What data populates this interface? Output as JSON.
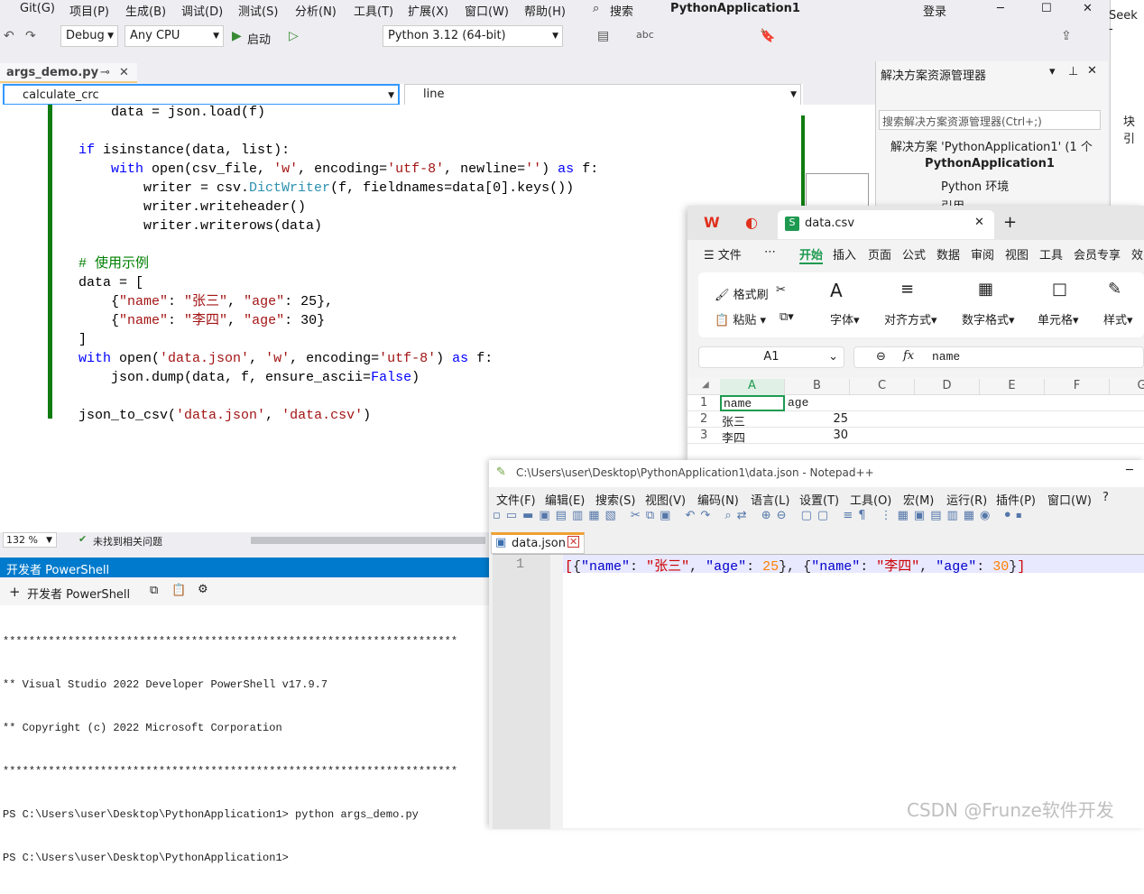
{
  "vs": {
    "menu": [
      "Git(G)",
      "项目(P)",
      "生成(B)",
      "调试(D)",
      "测试(S)",
      "分析(N)",
      "工具(T)",
      "扩展(X)",
      "窗口(W)",
      "帮助(H)"
    ],
    "search_label": "搜索",
    "app_title": "PythonApplication1",
    "login": "登录",
    "config": "Debug",
    "platform": "Any CPU",
    "start": "启动",
    "interpreter": "Python 3.12 (64-bit)",
    "doc_tab": "args_demo.py",
    "nav_left": "calculate_crc",
    "nav_right": "line",
    "zoom": "132 %",
    "issues": "未找到相关问题",
    "code": [
      "    data = json.load(f)",
      "",
      "if isinstance(data, list):",
      "    with open(csv_file, 'w', encoding='utf-8', newline='') as f:",
      "        writer = csv.DictWriter(f, fieldnames=data[0].keys())",
      "        writer.writeheader()",
      "        writer.writerows(data)",
      "",
      "# 使用示例",
      "data = [",
      "    {\"name\": \"张三\", \"age\": 25},",
      "    {\"name\": \"李四\", \"age\": 30}",
      "]",
      "with open('data.json', 'w', encoding='utf-8') as f:",
      "    json.dump(data, f, ensure_ascii=False)",
      "",
      "json_to_csv('data.json', 'data.csv')"
    ]
  },
  "solution": {
    "title": "解决方案资源管理器",
    "search_placeholder": "搜索解决方案资源管理器(Ctrl+;)",
    "items": [
      "解决方案 'PythonApplication1' (1 个",
      "PythonApplication1",
      "Python 环境",
      "引用"
    ]
  },
  "right_edge": {
    "top": "Seek -",
    "label": "块引"
  },
  "powershell": {
    "title": "开发者 PowerShell",
    "new_button": "开发者 PowerShell",
    "lines": [
      "**********************************************************************",
      "** Visual Studio 2022 Developer PowerShell v17.9.7",
      "** Copyright (c) 2022 Microsoft Corporation",
      "**********************************************************************",
      "PS C:\\Users\\user\\Desktop\\PythonApplication1> python args_demo.py",
      "PS C:\\Users\\user\\Desktop\\PythonApplication1>"
    ]
  },
  "wps": {
    "tab_title": "data.csv",
    "menu": [
      "文件",
      "开始",
      "插入",
      "页面",
      "公式",
      "数据",
      "审阅",
      "视图",
      "工具",
      "会员专享",
      "效"
    ],
    "ribbon": [
      "格式刷",
      "粘贴",
      "字体",
      "对齐方式",
      "数字格式",
      "单元格",
      "样式"
    ],
    "cell_ref": "A1",
    "fx": "fx",
    "formula": "name",
    "columns": [
      "A",
      "B",
      "C",
      "D",
      "E",
      "F",
      "G"
    ],
    "rows": [
      {
        "n": "1",
        "a": "name",
        "b": "age"
      },
      {
        "n": "2",
        "a": "张三",
        "b": "25"
      },
      {
        "n": "3",
        "a": "李四",
        "b": "30"
      }
    ]
  },
  "notepad": {
    "title": "C:\\Users\\user\\Desktop\\PythonApplication1\\data.json - Notepad++",
    "menu": [
      "文件(F)",
      "编辑(E)",
      "搜索(S)",
      "视图(V)",
      "编码(N)",
      "语言(L)",
      "设置(T)",
      "工具(O)",
      "宏(M)",
      "运行(R)",
      "插件(P)",
      "窗口(W)",
      "?"
    ],
    "tab": "data.json",
    "line_no": "1"
  },
  "watermark": "CSDN @Frunze软件开发"
}
